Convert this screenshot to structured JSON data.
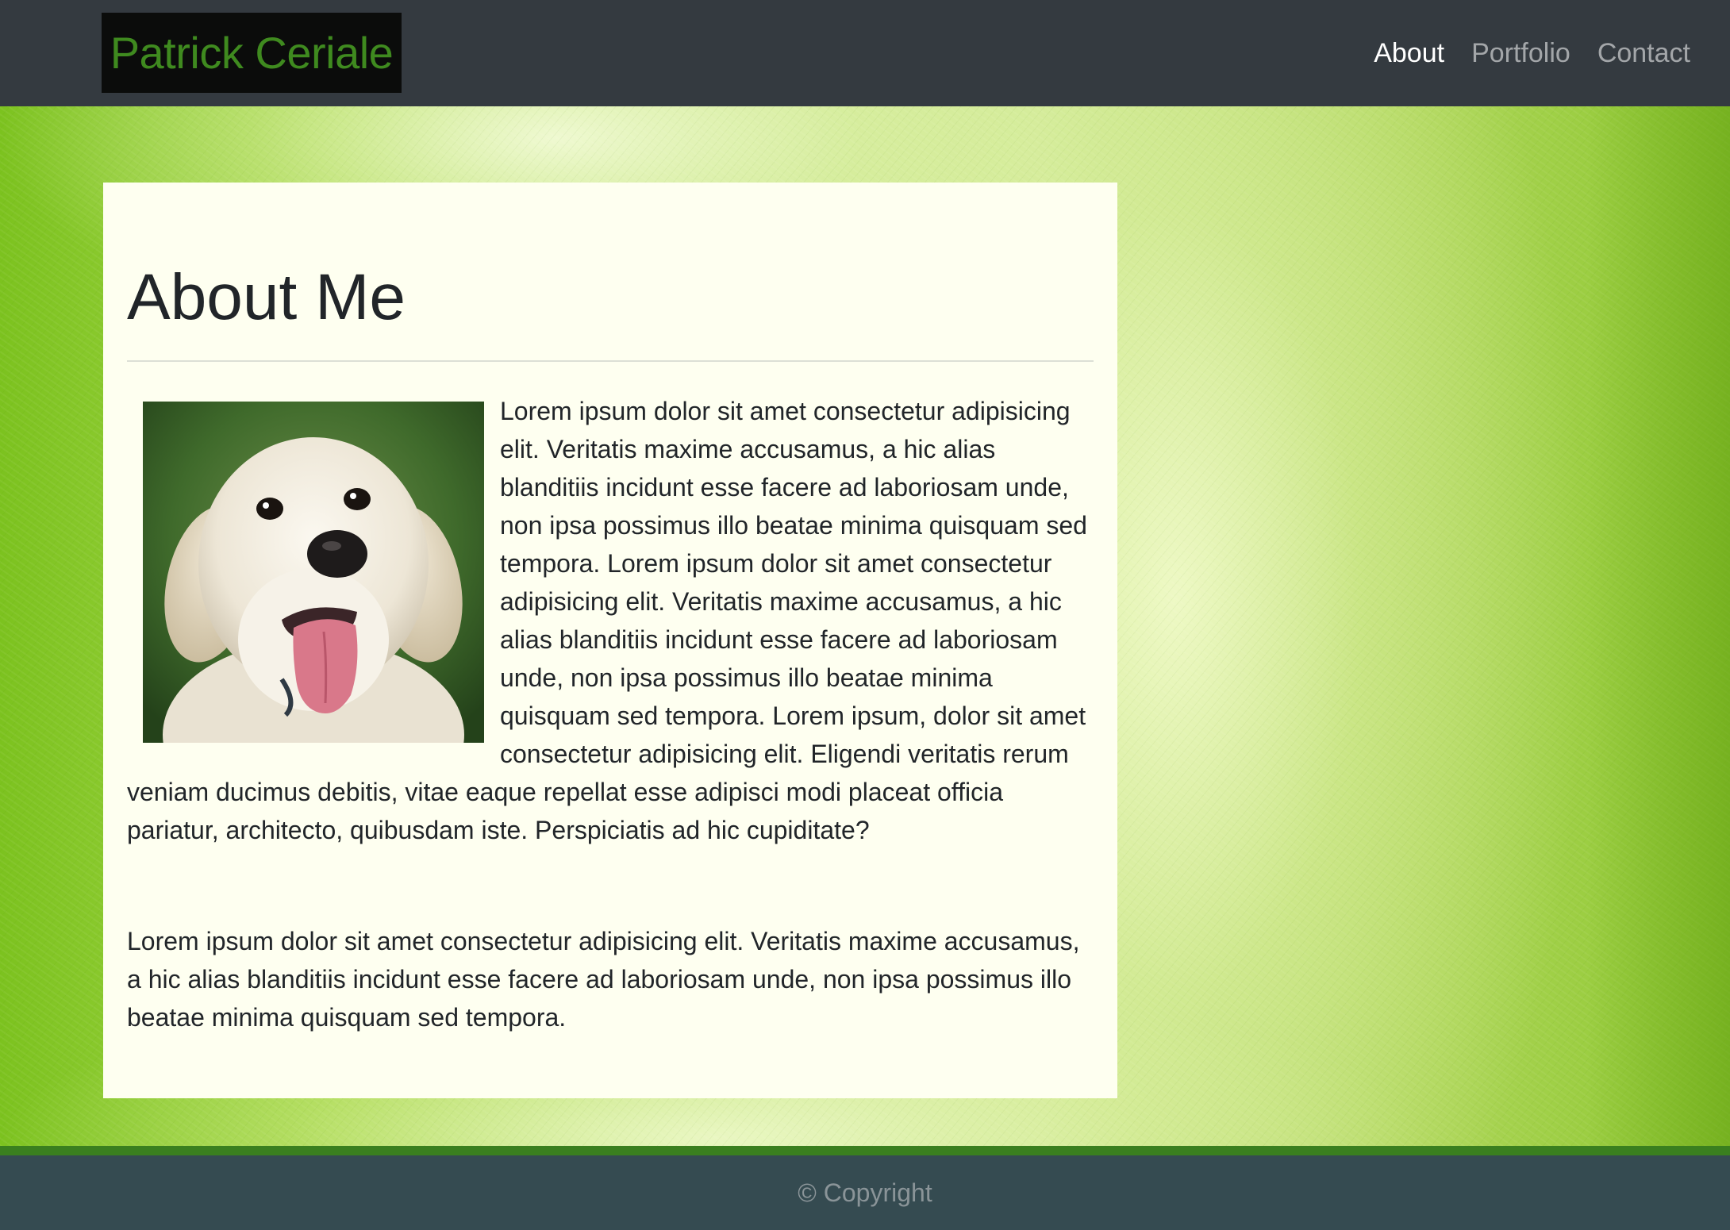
{
  "navbar": {
    "brand": "Patrick Ceriale",
    "links": [
      {
        "label": "About",
        "active": true
      },
      {
        "label": "Portfolio",
        "active": false
      },
      {
        "label": "Contact",
        "active": false
      }
    ]
  },
  "main": {
    "title": "About Me",
    "image_alt": "puppy-photo",
    "paragraph_1": "Lorem ipsum dolor sit amet consectetur adipisicing elit. Veritatis maxime accusamus, a hic alias blanditiis incidunt esse facere ad laboriosam unde, non ipsa possimus illo beatae minima quisquam sed tempora. Lorem ipsum dolor sit amet consectetur adipisicing elit. Veritatis maxime accusamus, a hic alias blanditiis incidunt esse facere ad laboriosam unde, non ipsa possimus illo beatae minima quisquam sed tempora. Lorem ipsum, dolor sit amet consectetur adipisicing elit. Eligendi veritatis rerum veniam ducimus debitis, vitae eaque repellat esse adipisci modi placeat officia pariatur, architecto, quibusdam iste. Perspiciatis ad hic cupiditate?",
    "paragraph_2": "Lorem ipsum dolor sit amet consectetur adipisicing elit. Veritatis maxime accusamus, a hic alias blanditiis incidunt esse facere ad laboriosam unde, non ipsa possimus illo beatae minima quisquam sed tempora."
  },
  "footer": {
    "text": "© Copyright"
  },
  "colors": {
    "navbar_bg": "#343a40",
    "brand_text": "#3f8a1f",
    "card_bg": "#fefff0",
    "footer_bg": "#354b51",
    "footer_stripe": "#3a7f1f"
  }
}
